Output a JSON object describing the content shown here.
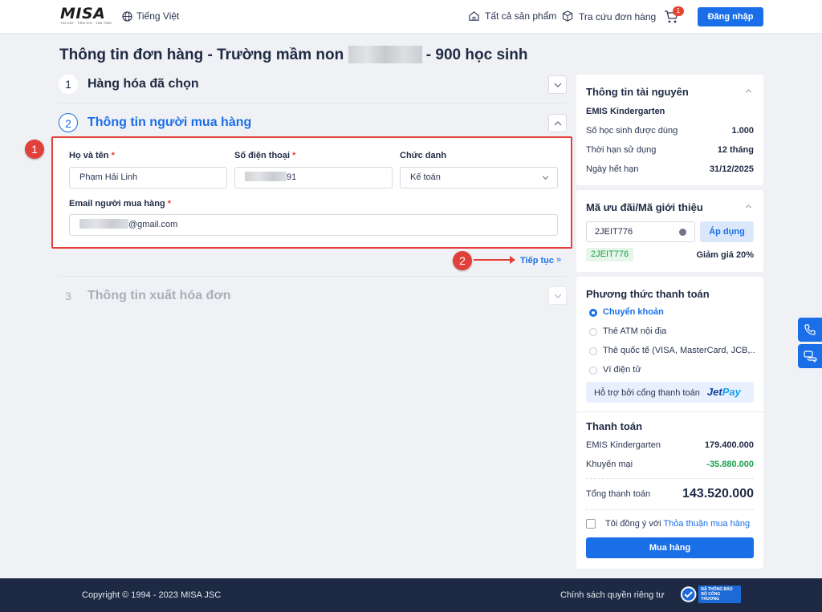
{
  "header": {
    "logo": "MISA",
    "logo_tagline": "TIN CẬY · TIỆN ÍCH · TẬN TÌNH",
    "language": "Tiếng Việt",
    "all_products": "Tất cả sản phẩm",
    "order_lookup": "Tra cứu đơn hàng",
    "cart_count": "1",
    "login": "Đăng nhập"
  },
  "page": {
    "title_prefix": "Thông tin đơn hàng - Trường mầm non",
    "title_suffix": "- 900 học sinh"
  },
  "steps": [
    {
      "num": "1",
      "label": "Hàng hóa đã chọn"
    },
    {
      "num": "2",
      "label": "Thông tin người mua hàng"
    },
    {
      "num": "3",
      "label": "Thông tin xuất hóa đơn"
    }
  ],
  "form": {
    "name_label": "Họ và tên",
    "name_value": "Phạm Hải Linh",
    "phone_label": "Số điện thoại",
    "phone_suffix": "91",
    "title_label": "Chức danh",
    "title_value": "Kế toán",
    "email_label": "Email người mua hàng",
    "email_suffix": "@gmail.com",
    "required_mark": "*",
    "next": "Tiếp tục",
    "next_chevron": "»"
  },
  "markers": [
    "1",
    "2"
  ],
  "resources": {
    "title": "Thông tin tài nguyên",
    "product": "EMIS Kindergarten",
    "rows": [
      {
        "label": "Số học sinh được dùng",
        "value": "1.000"
      },
      {
        "label": "Thời hạn sử dụng",
        "value": "12 tháng"
      },
      {
        "label": "Ngày hết hạn",
        "value": "31/12/2025"
      }
    ]
  },
  "promo": {
    "title": "Mã ưu đãi/Mã giới thiệu",
    "code": "2JEIT776",
    "apply": "Áp dụng",
    "applied_code": "2JEIT776",
    "discount": "Giảm giá 20%"
  },
  "payment": {
    "title": "Phương thức thanh toán",
    "options": [
      {
        "label": "Chuyển khoản",
        "selected": true
      },
      {
        "label": "Thẻ ATM nội địa",
        "selected": false
      },
      {
        "label": "Thẻ quốc tế (VISA, MasterCard, JCB,..",
        "selected": false
      },
      {
        "label": "Ví điện tử",
        "selected": false
      }
    ],
    "gateway_text": "Hỗ trợ bởi cổng thanh toán",
    "gateway_logo_a": "Jet",
    "gateway_logo_b": "Pay"
  },
  "summary": {
    "title": "Thanh toán",
    "product_label": "EMIS Kindergarten",
    "product_price": "179.400.000",
    "promo_label": "Khuyến mại",
    "promo_value": "-35.880.000",
    "total_label": "Tổng thanh toán",
    "total_value": "143.520.000",
    "agree_prefix": "Tôi đồng ý với",
    "agree_link": "Thỏa thuận mua hàng",
    "buy": "Mua hàng"
  },
  "footer": {
    "copyright": "Copyright © 1994 - 2023 MISA JSC",
    "policy": "Chính sách quyền riêng tư",
    "badge_line1": "ĐÃ THÔNG BÁO",
    "badge_line2": "BỘ CÔNG THƯƠNG"
  },
  "colors": {
    "accent": "#1a6fe8",
    "highlight": "#e2403a",
    "discount_green": "#1aa04a",
    "footer_bg": "#1e2a44"
  }
}
